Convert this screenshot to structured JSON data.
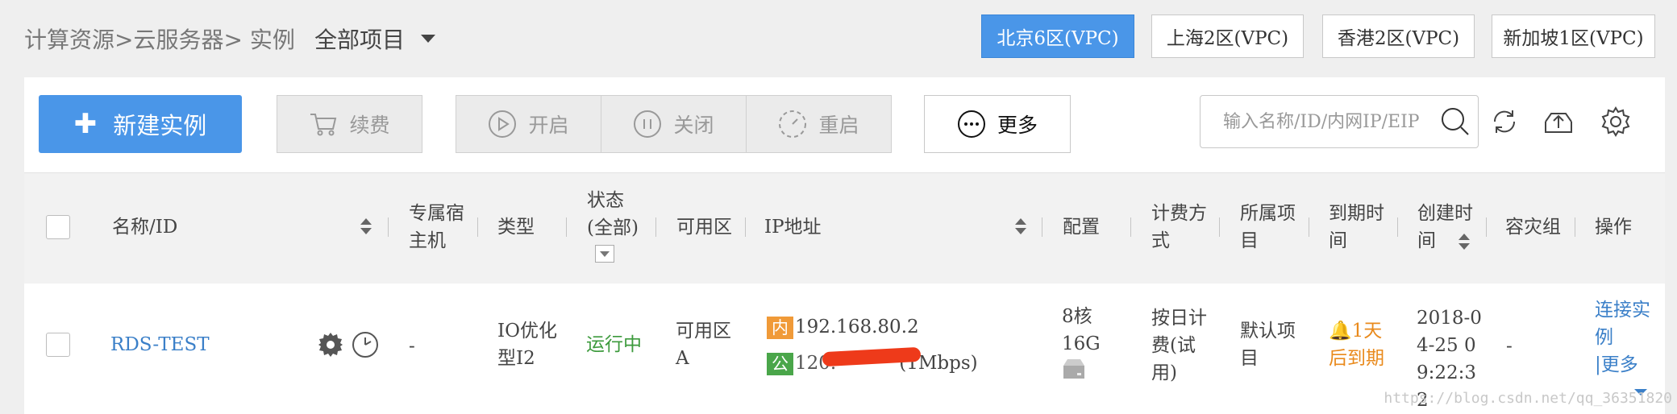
{
  "breadcrumb": "计算资源>云服务器> 实例",
  "project_selector": "全部项目",
  "regions": [
    "北京6区(VPC)",
    "上海2区(VPC)",
    "香港2区(VPC)",
    "新加坡1区(VPC)"
  ],
  "toolbar": {
    "new_instance": "新建实例",
    "renew": "续费",
    "start": "开启",
    "stop": "关闭",
    "restart": "重启",
    "more": "更多",
    "search_placeholder": "输入名称/ID/内网IP/EIP"
  },
  "columns": {
    "name": "名称/ID",
    "dedicated_host": "专属宿主机",
    "type": "类型",
    "status": "状态(全部)",
    "zone": "可用区",
    "ip": "IP地址",
    "config": "配置",
    "billing": "计费方式",
    "project": "所属项目",
    "expire": "到期时间",
    "created": "创建时间",
    "dr_group": "容灾组",
    "ops": "操作"
  },
  "row": {
    "name": "RDS-TEST",
    "dedicated_host": "-",
    "type": "IO优化型I2",
    "status": "运行中",
    "zone": "可用区A",
    "ip_internal_tag": "内",
    "ip_internal": "192.168.80.2",
    "ip_public_tag": "公",
    "ip_public_visible_prefix": "120.",
    "ip_public_bandwidth": "(1Mbps)",
    "config": "8核16G",
    "billing": "按日计费(试用)",
    "project": "默认项目",
    "expire": "1天后到期",
    "created": "2018-04-25 09:22:32",
    "dr_group": "-",
    "op_connect": "连接实例",
    "op_more": "|更多"
  },
  "watermark": "https://blog.csdn.net/qq_36351820",
  "colors": {
    "accent": "#4a96e8",
    "link": "#3a7fc8",
    "running": "#3c9a3c",
    "warning": "#e98a1c",
    "tag_internal": "#f09a38",
    "tag_public": "#4aa64a"
  }
}
